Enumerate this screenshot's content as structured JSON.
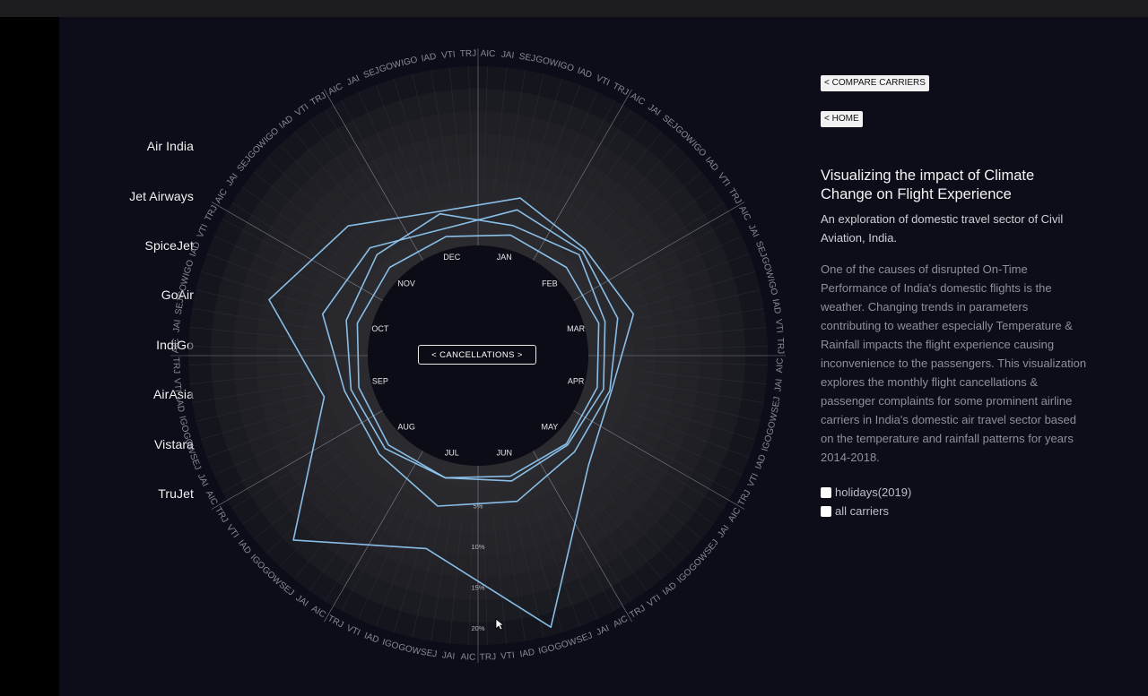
{
  "nav": {
    "compare_label": "< COMPARE CARRIERS",
    "home_label": "< HOME"
  },
  "panel": {
    "title": "Visualizing the impact of Climate Change on Flight Experience",
    "subtitle": "An exploration of domestic travel sector of Civil Aviation, India.",
    "body": "One of the causes of disrupted On-Time Performance of India's domestic flights is the weather. Changing trends in parameters contributing to weather especially Temperature & Rainfall impacts the flight experience causing inconvenience to the passengers. This visualization explores the monthly flight cancellations & passenger complaints for some prominent airline carriers in India's domestic air travel sector based on the temperature and rainfall patterns for years 2014-2018."
  },
  "toggles": [
    {
      "label": "holidays(2019)",
      "checked": false
    },
    {
      "label": "all carriers",
      "checked": false
    }
  ],
  "carriers": [
    "Air India",
    "Jet Airways",
    "SpiceJet",
    "GoAir",
    "IndiGo",
    "AirAsia",
    "Vistara",
    "TruJet"
  ],
  "center_label": "< CANCELLATIONS >",
  "chart_data": {
    "type": "radar",
    "metric": "cancellations",
    "categories": [
      "JAN",
      "FEB",
      "MAR",
      "APR",
      "MAY",
      "JUN",
      "JUL",
      "AUG",
      "SEP",
      "OCT",
      "NOV",
      "DEC"
    ],
    "outer_ring_labels": [
      "AIC",
      "JAI",
      "SEJ",
      "GOW",
      "IGO",
      "IAD",
      "VTI",
      "TRJ"
    ],
    "radial_ticks": [
      "5%",
      "10%",
      "15%",
      "20%"
    ],
    "radial_tick_values": [
      5,
      10,
      15,
      20
    ],
    "rlim": [
      0,
      22
    ],
    "series": [
      {
        "values": [
          1.8,
          1.8,
          1.8,
          1.6,
          1.8,
          1.8,
          2.0,
          2.0,
          1.6,
          1.8,
          1.8,
          1.6
        ]
      },
      {
        "values": [
          3.0,
          4.0,
          2.6,
          2.4,
          2.0,
          2.4,
          2.0,
          2.6,
          2.6,
          3.2,
          4.0,
          4.5
        ]
      },
      {
        "values": [
          5.0,
          4.6,
          4.2,
          3.2,
          3.2,
          5.0,
          5.6,
          3.6,
          3.4,
          6.2,
          5.2,
          2.6
        ]
      },
      {
        "values": [
          6.5,
          5.0,
          6.2,
          3.4,
          5.6,
          21.0,
          11.0,
          18.5,
          6.0,
          13.0,
          9.0,
          4.8
        ]
      }
    ],
    "grid": true,
    "legend": "none",
    "colors": {
      "series": "#8ec6f0",
      "ring": "#8a8a94"
    }
  }
}
